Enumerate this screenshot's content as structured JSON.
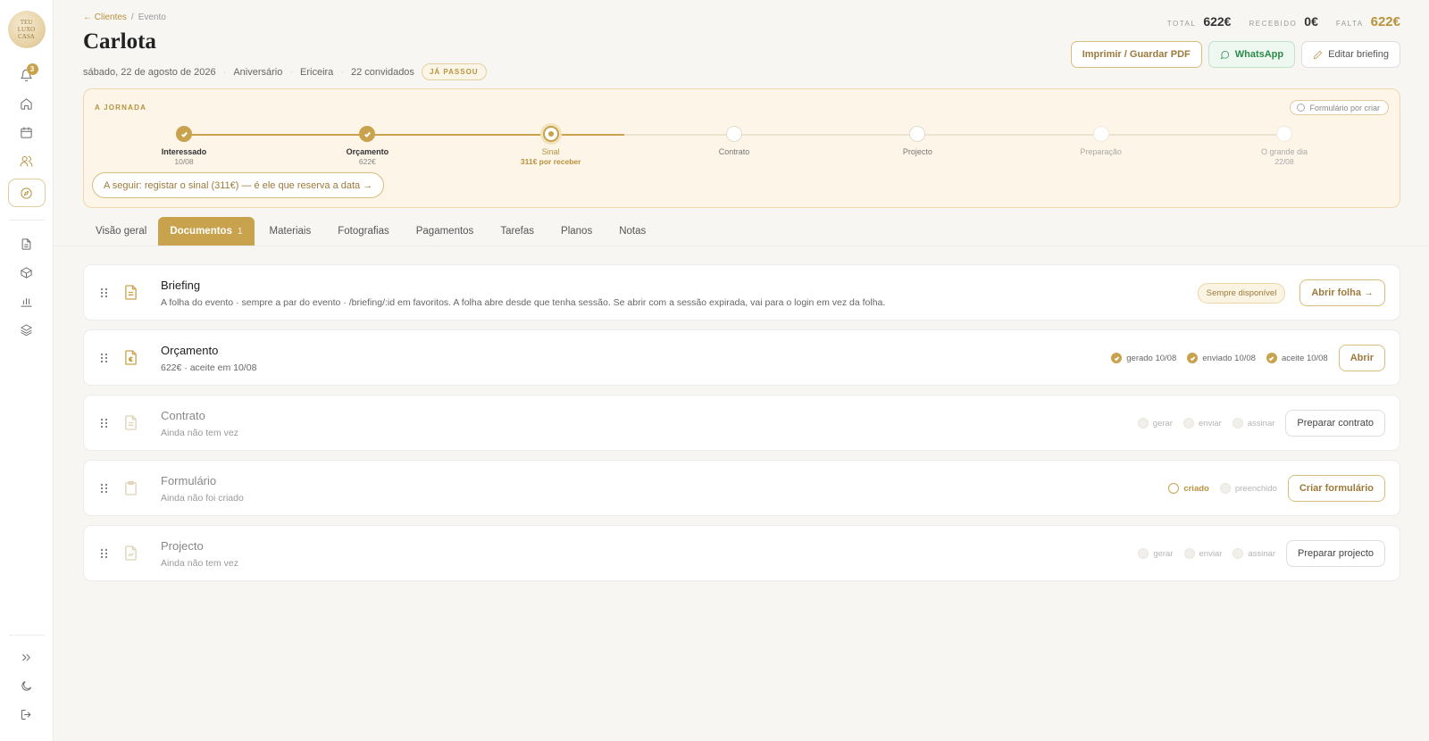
{
  "sidebar": {
    "logo_text": "TEU\nLUXO\nCASA",
    "notifications_count": "3",
    "items": [
      {
        "name": "bell-icon"
      },
      {
        "name": "home-icon"
      },
      {
        "name": "calendar-icon"
      },
      {
        "name": "users-icon"
      },
      {
        "name": "compass-icon"
      },
      {
        "name": "document-icon"
      },
      {
        "name": "box-icon"
      },
      {
        "name": "chart-icon"
      },
      {
        "name": "layers-icon"
      }
    ],
    "bottom": [
      {
        "name": "expand-icon"
      },
      {
        "name": "moon-icon"
      },
      {
        "name": "logout-icon"
      }
    ]
  },
  "header": {
    "breadcrumb_back": "← Clientes",
    "breadcrumb_sep": "/",
    "breadcrumb_current": "Evento",
    "title": "Carlota",
    "date": "sábado, 22 de agosto de 2026",
    "type": "Aniversário",
    "location": "Ericeira",
    "guests": "22 convidados",
    "status_badge": "JÁ PASSOU",
    "totals": {
      "total_label": "TOTAL",
      "total_value": "622€",
      "received_label": "RECEBIDO",
      "received_value": "0€",
      "missing_label": "FALTA",
      "missing_value": "622€"
    },
    "actions": {
      "print": "Imprimir / Guardar PDF",
      "whatsapp": "WhatsApp",
      "edit": "Editar briefing"
    }
  },
  "journey": {
    "label": "A JORNADA",
    "form_status": "Formulário por criar",
    "progress_fraction": 0.4,
    "steps": [
      {
        "name": "Interessado",
        "sub": "10/08",
        "state": "done"
      },
      {
        "name": "Orçamento",
        "sub": "622€",
        "state": "done"
      },
      {
        "name": "Sinal",
        "sub": "311€ por receber",
        "state": "current"
      },
      {
        "name": "Contrato",
        "sub": "",
        "state": "todo"
      },
      {
        "name": "Projecto",
        "sub": "",
        "state": "todo"
      },
      {
        "name": "Preparação",
        "sub": "",
        "state": "faded"
      },
      {
        "name": "O grande dia",
        "sub": "22/08",
        "state": "faded"
      }
    ],
    "next_action": "A seguir: registar o sinal (311€) — é ele que reserva a data →"
  },
  "tabs": [
    {
      "label": "Visão geral",
      "count": ""
    },
    {
      "label": "Documentos",
      "count": "1",
      "active": true
    },
    {
      "label": "Materiais",
      "count": ""
    },
    {
      "label": "Fotografias",
      "count": ""
    },
    {
      "label": "Pagamentos",
      "count": ""
    },
    {
      "label": "Tarefas",
      "count": ""
    },
    {
      "label": "Planos",
      "count": ""
    },
    {
      "label": "Notas",
      "count": ""
    }
  ],
  "documents": {
    "briefing": {
      "title": "Briefing",
      "subtitle": "A folha do evento · sempre a par do evento · /briefing/:id em favoritos. A folha abre desde que tenha sessão. Se abrir com a sessão expirada, vai para o login em vez da folha.",
      "badge": "Sempre disponível",
      "button": "Abrir folha →"
    },
    "orcamento": {
      "title": "Orçamento",
      "subtitle": "622€ · aceite em 10/08",
      "checks": [
        "gerado 10/08",
        "enviado 10/08",
        "aceite 10/08"
      ],
      "button": "Abrir"
    },
    "contrato": {
      "title": "Contrato",
      "subtitle": "Ainda não tem vez",
      "checks": [
        "gerar",
        "enviar",
        "assinar"
      ],
      "button": "Preparar contrato"
    },
    "formulario": {
      "title": "Formulário",
      "subtitle": "Ainda não foi criado",
      "checks": [
        "criado",
        "preenchido"
      ],
      "button": "Criar formulário"
    },
    "projecto": {
      "title": "Projecto",
      "subtitle": "Ainda não tem vez",
      "checks": [
        "gerar",
        "enviar",
        "assinar"
      ],
      "button": "Preparar projecto"
    }
  },
  "colors": {
    "accent": "#c9a24d",
    "accent_dark": "#9c7a3b",
    "journey_bg": "#fcf5e8",
    "whatsapp": "#2d8a4a"
  }
}
